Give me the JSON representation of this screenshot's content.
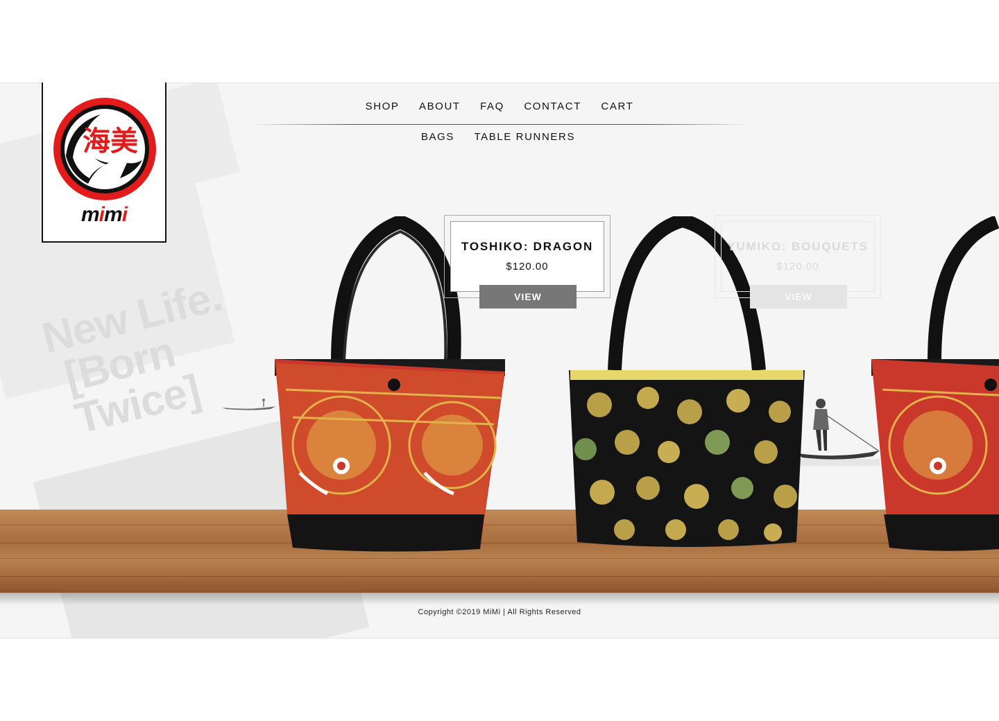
{
  "brand": {
    "logo_kanji": "海美",
    "wordmark": "mimi",
    "colors": {
      "red": "#e31b1b",
      "black": "#111111"
    }
  },
  "tagline": {
    "line1": "New Life.",
    "line2": "[Born Twice]"
  },
  "nav": {
    "main": [
      "SHOP",
      "ABOUT",
      "FAQ",
      "CONTACT",
      "CART"
    ],
    "sub": [
      "BAGS",
      "TABLE RUNNERS"
    ]
  },
  "products": [
    {
      "name": "TOSHIKO: DRAGON",
      "price": "$120.00",
      "button": "VIEW",
      "state": "active"
    },
    {
      "name": "YUMIKO: BOUQUETS",
      "price": "$120.00",
      "button": "VIEW",
      "state": "faded"
    }
  ],
  "footer": {
    "copyright": "Copyright ©2019 MiMi | All Rights Reserved"
  }
}
